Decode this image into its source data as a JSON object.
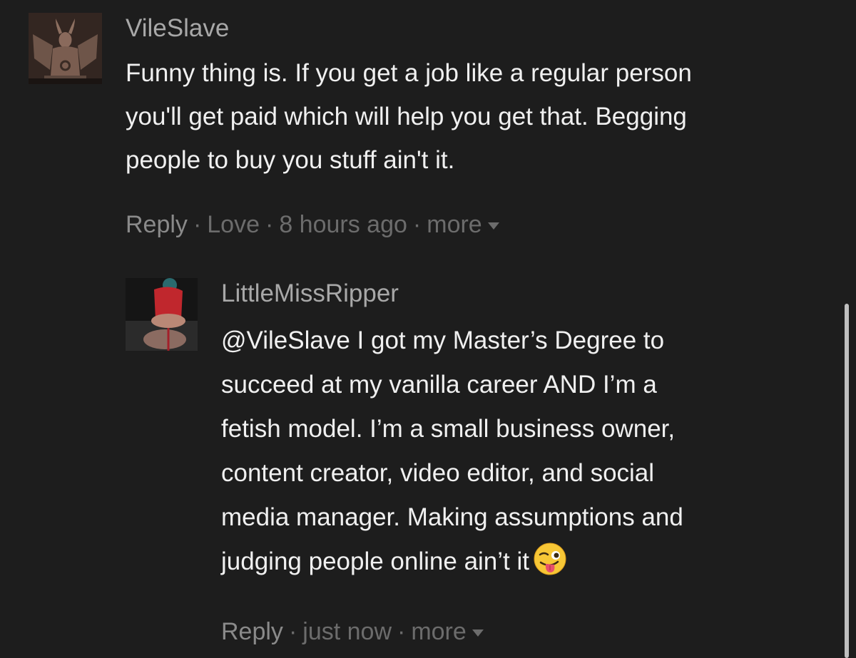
{
  "comments": [
    {
      "username": "VileSlave",
      "text": "Funny thing is. If you get a job like a regular person\nyou'll get paid which will help you get that. Begging\npeople to buy you stuff ain't it.",
      "actions": {
        "reply": "Reply",
        "love": "Love",
        "time": "8 hours ago",
        "more": "more"
      },
      "avatar_icon": "goat-idol-avatar"
    },
    {
      "username": "LittleMissRipper",
      "text": "@VileSlave I got my Master’s Degree to\nsucceed at my vanilla career AND I’m a\nfetish model. I’m a small business owner,\ncontent creator, video editor, and social\nmedia manager. Making assumptions and\njudging people online ain’t it",
      "emoji": "winking-face-with-tongue-icon",
      "actions": {
        "reply": "Reply",
        "time": "just now",
        "more": "more"
      },
      "avatar_icon": "user-photo-avatar"
    }
  ],
  "separator": "·",
  "colors": {
    "background": "#1d1d1d",
    "username": "#a8a8a8",
    "text": "#f0f0f0",
    "meta": "#6c6c6c"
  }
}
